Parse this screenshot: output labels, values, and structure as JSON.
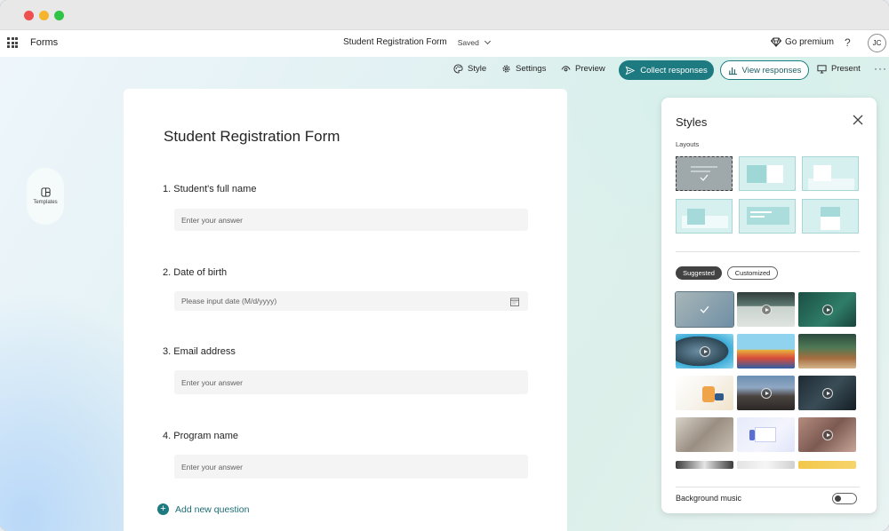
{
  "app": {
    "name": "Forms"
  },
  "document": {
    "title": "Student Registration Form",
    "status": "Saved"
  },
  "header": {
    "premium_label": "Go premium",
    "help_label": "?",
    "avatar_initials": "JC"
  },
  "commands": {
    "style": "Style",
    "settings": "Settings",
    "preview": "Preview",
    "collect": "Collect responses",
    "view": "View responses",
    "present": "Present",
    "more": "···"
  },
  "templates": {
    "label": "Templates"
  },
  "form": {
    "title": "Student Registration Form",
    "questions": [
      {
        "label": "1. Student's full name",
        "placeholder": "Enter your answer"
      },
      {
        "label": "2. Date of birth",
        "placeholder": "Please input date (M/d/yyyy)"
      },
      {
        "label": "3. Email address",
        "placeholder": "Enter your answer"
      },
      {
        "label": "4. Program name",
        "placeholder": "Enter your answer"
      }
    ],
    "add_question": "Add new question"
  },
  "styles_panel": {
    "title": "Styles",
    "layouts_label": "Layouts",
    "tabs": {
      "suggested": "Suggested",
      "customized": "Customized"
    },
    "background_music": "Background music",
    "background_music_on": false
  },
  "colors": {
    "accent": "#1c7a80",
    "layout_fill": "#d6f0ef",
    "selected_layout": "#9fa9ab"
  }
}
